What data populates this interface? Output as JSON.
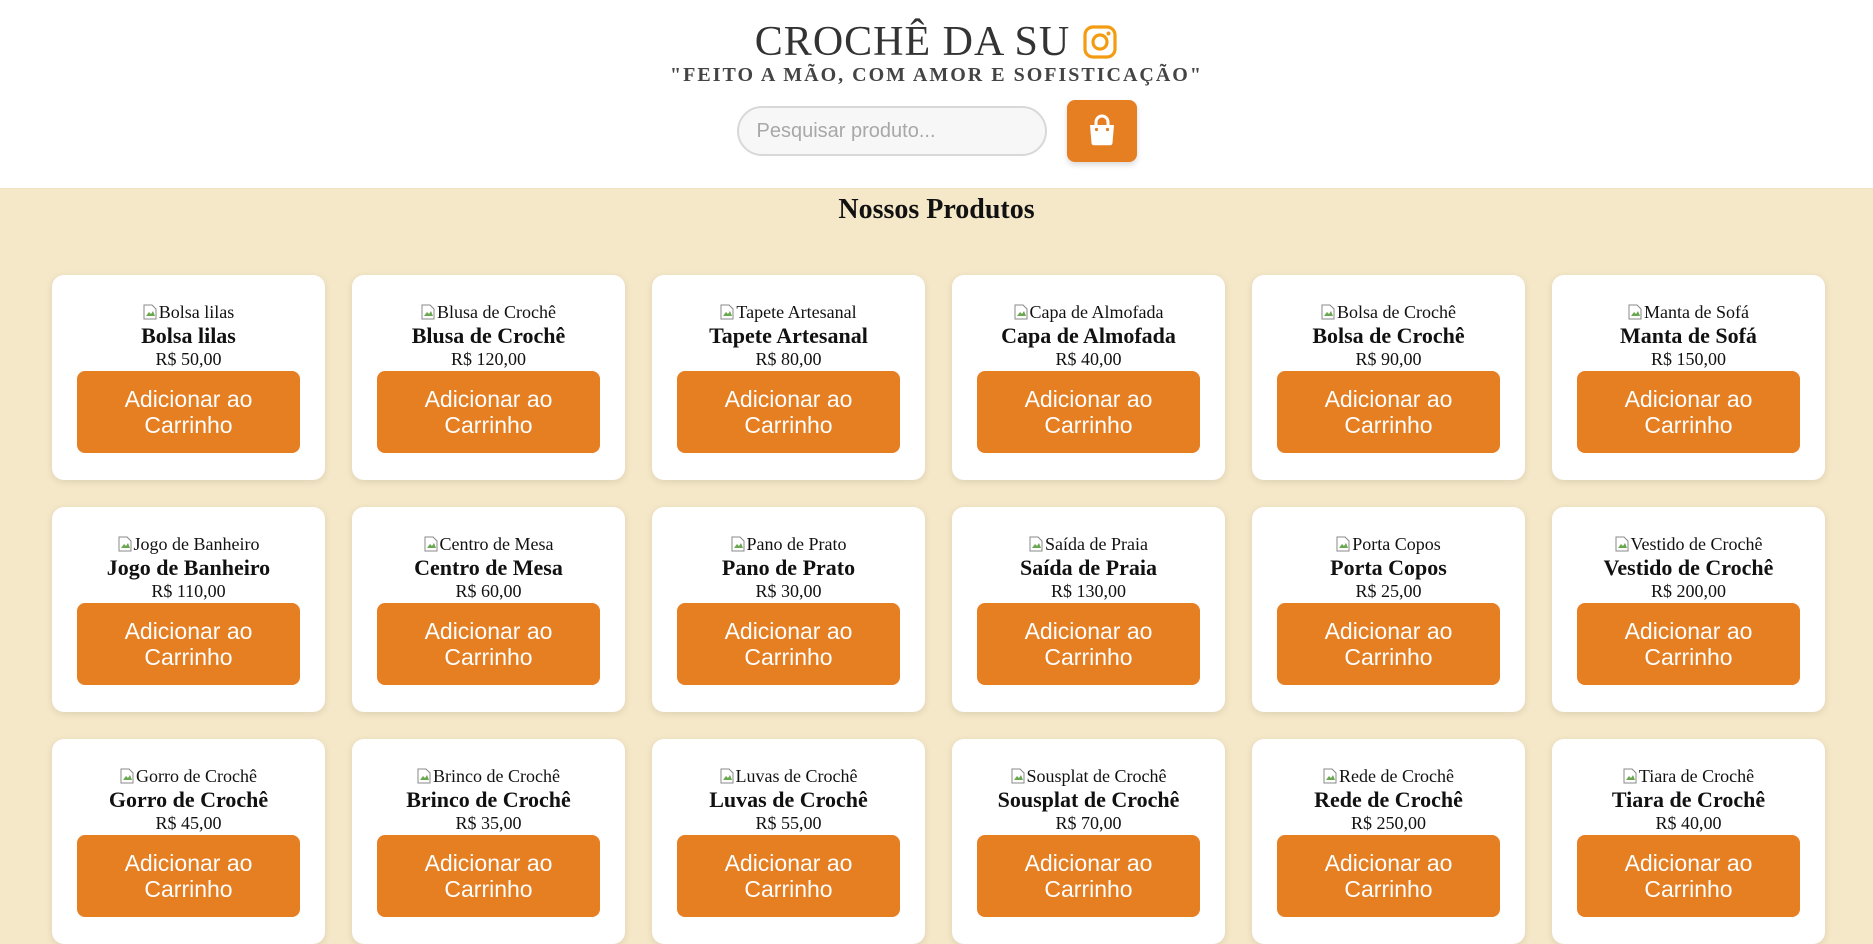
{
  "header": {
    "brand": "CROCHÊ DA SU",
    "tagline": "\"FEITO A MÃO, COM AMOR E SOFISTICAÇÃO\"",
    "instagram_icon": "instagram-icon",
    "search_placeholder": "Pesquisar produto...",
    "cart_icon": "shopping-bag-icon"
  },
  "colors": {
    "accent": "#e67e22",
    "background": "#f5e8c8",
    "header_bg": "#ffffff"
  },
  "main": {
    "section_title": "Nossos Produtos",
    "add_button_label": "Adicionar ao Carrinho",
    "products": [
      {
        "alt": "Bolsa lilas",
        "name": "Bolsa lilas",
        "price": "R$ 50,00"
      },
      {
        "alt": "Blusa de Crochê",
        "name": "Blusa de Crochê",
        "price": "R$ 120,00"
      },
      {
        "alt": "Tapete Artesanal",
        "name": "Tapete Artesanal",
        "price": "R$ 80,00"
      },
      {
        "alt": "Capa de Almofada",
        "name": "Capa de Almofada",
        "price": "R$ 40,00"
      },
      {
        "alt": "Bolsa de Crochê",
        "name": "Bolsa de Crochê",
        "price": "R$ 90,00"
      },
      {
        "alt": "Manta de Sofá",
        "name": "Manta de Sofá",
        "price": "R$ 150,00"
      },
      {
        "alt": "Jogo de Banheiro",
        "name": "Jogo de Banheiro",
        "price": "R$ 110,00"
      },
      {
        "alt": "Centro de Mesa",
        "name": "Centro de Mesa",
        "price": "R$ 60,00"
      },
      {
        "alt": "Pano de Prato",
        "name": "Pano de Prato",
        "price": "R$ 30,00"
      },
      {
        "alt": "Saída de Praia",
        "name": "Saída de Praia",
        "price": "R$ 130,00"
      },
      {
        "alt": "Porta Copos",
        "name": "Porta Copos",
        "price": "R$ 25,00"
      },
      {
        "alt": "Vestido de Crochê",
        "name": "Vestido de Crochê",
        "price": "R$ 200,00"
      },
      {
        "alt": "Gorro de Crochê",
        "name": "Gorro de Crochê",
        "price": "R$ 45,00"
      },
      {
        "alt": "Brinco de Crochê",
        "name": "Brinco de Crochê",
        "price": "R$ 35,00"
      },
      {
        "alt": "Luvas de Crochê",
        "name": "Luvas de Crochê",
        "price": "R$ 55,00"
      },
      {
        "alt": "Sousplat de Crochê",
        "name": "Sousplat de Crochê",
        "price": "R$ 70,00"
      },
      {
        "alt": "Rede de Crochê",
        "name": "Rede de Crochê",
        "price": "R$ 250,00"
      },
      {
        "alt": "Tiara de Crochê",
        "name": "Tiara de Crochê",
        "price": "R$ 40,00"
      }
    ]
  }
}
